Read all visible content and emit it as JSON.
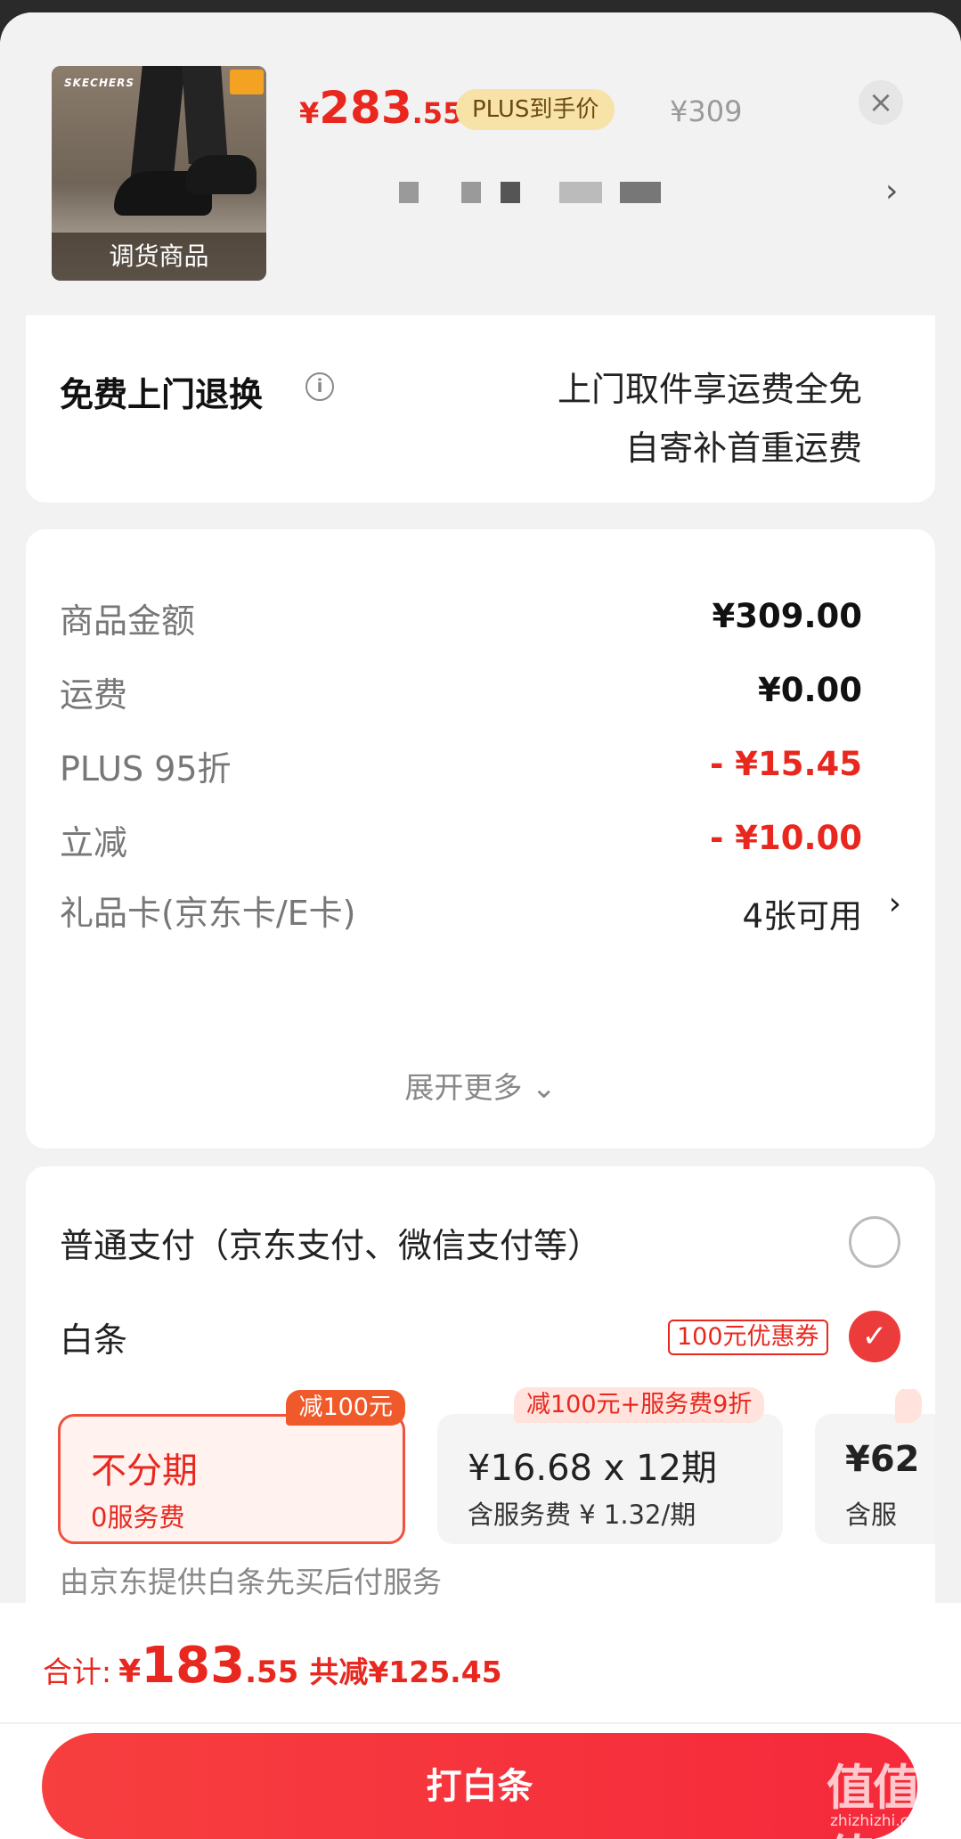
{
  "product": {
    "thumbnail_brand": "SKECHERS",
    "thumbnail_badge": "调货商品",
    "price_symbol": "¥",
    "price_integer": "283",
    "price_decimal": ".55",
    "plus_tag": "PLUS到手价",
    "original_price": "¥309",
    "close_icon": "close-icon"
  },
  "return_service": {
    "title": "免费上门退换",
    "line1": "上门取件享运费全免",
    "line2": "自寄补首重运费"
  },
  "fees": [
    {
      "label": "商品金额",
      "value": "¥309.00",
      "style": "bold"
    },
    {
      "label": "运费",
      "value": "¥0.00",
      "style": "bold"
    },
    {
      "label": "PLUS 95折",
      "value": "- ¥15.45",
      "style": "red"
    },
    {
      "label": "立减",
      "value": "- ¥10.00",
      "style": "red"
    },
    {
      "label": "礼品卡(京东卡/E卡)",
      "value": "4张可用",
      "style": "link"
    }
  ],
  "expand_more": "展开更多 ⌄",
  "payment": {
    "normal_label": "普通支付（京东支付、微信支付等）",
    "baitiao_label": "白条",
    "coupon_tag": "100元优惠券",
    "plans": [
      {
        "title": "不分期",
        "sub": "0服务费",
        "badge": "减100元",
        "selected": true
      },
      {
        "title": "¥16.68 x 12期",
        "sub": "含服务费 ¥ 1.32/期",
        "badge": "减100元+服务费9折",
        "selected": false
      },
      {
        "title": "¥62",
        "sub": "含服",
        "badge": "",
        "selected": false
      }
    ],
    "note": "由京东提供白条先买后付服务"
  },
  "total": {
    "label": "合计:",
    "symbol": "¥",
    "integer": "183",
    "decimal": ".55",
    "saving": "共减¥125.45"
  },
  "pay_button": "打白条",
  "watermark": {
    "main": "值值值",
    "sub": "zhizhizhi.com"
  },
  "colors": {
    "accent": "#e8281f",
    "button": "#f5293b",
    "plus_tag_bg": "#f7e3a8"
  }
}
